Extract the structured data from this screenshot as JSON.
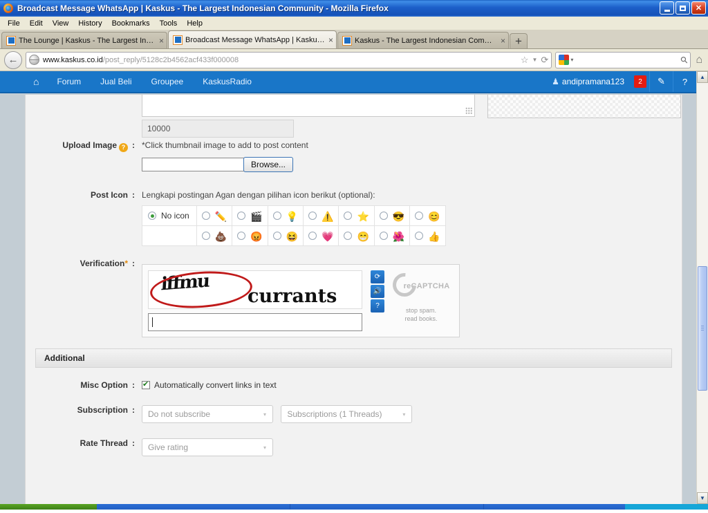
{
  "window": {
    "title": "Broadcast Message WhatsApp | Kaskus - The Largest Indonesian Community - Mozilla Firefox",
    "minimize_label": "Minimize",
    "restore_label": "Restore",
    "close_label": "Close"
  },
  "menu": [
    {
      "label": "File"
    },
    {
      "label": "Edit"
    },
    {
      "label": "View"
    },
    {
      "label": "History"
    },
    {
      "label": "Bookmarks"
    },
    {
      "label": "Tools"
    },
    {
      "label": "Help"
    }
  ],
  "tabs": [
    {
      "title": "The Lounge | Kaskus - The Largest Indon...",
      "active": false,
      "close": "×"
    },
    {
      "title": "Broadcast Message WhatsApp | Kaskus -...",
      "active": true,
      "close": "×"
    },
    {
      "title": "Kaskus - The Largest Indonesian Commu...",
      "active": false,
      "close": "×"
    }
  ],
  "new_tab_label": "+",
  "toolbar": {
    "back_icon": "←",
    "url_domain": "www.kaskus.co.id",
    "url_path": "/post_reply/5128c2b4562acf433f000008",
    "bookmark_icon": "☆",
    "bookmark_caret": "▼",
    "reload_icon": "⟳",
    "search_caret": "▾",
    "search_icon": "⚲",
    "search_placeholder": "",
    "home_icon": "⌂"
  },
  "site_nav": {
    "home_icon": "⌂",
    "items": [
      {
        "label": "Forum"
      },
      {
        "label": "Jual Beli"
      },
      {
        "label": "Groupee"
      },
      {
        "label": "KaskusRadio"
      }
    ],
    "user_icon": "♟",
    "username": "andipramana123",
    "badge_count": "2",
    "pencil_icon": "✎",
    "help_icon": "?"
  },
  "form": {
    "char_counter_value": "10000",
    "upload_image": {
      "label": "Upload Image",
      "help_icon": "?",
      "colon": ":",
      "hint": "*Click thumbnail image to add to post content",
      "file_value": "",
      "browse_label": "Browse..."
    },
    "post_icon": {
      "label": "Post Icon",
      "colon": ":",
      "hint": "Lengkapi postingan Agan dengan pilihan icon berikut (optional):",
      "no_icon_label": "No icon",
      "no_icon_selected": true,
      "row1": [
        {
          "name": "pencil-icon",
          "glyph": "✏️",
          "selected": false
        },
        {
          "name": "clapperboard-icon",
          "glyph": "🎬",
          "selected": false
        },
        {
          "name": "lightbulb-icon",
          "glyph": "💡",
          "selected": false
        },
        {
          "name": "warning-icon",
          "glyph": "⚠️",
          "selected": false
        },
        {
          "name": "star-icon",
          "glyph": "⭐",
          "selected": false
        },
        {
          "name": "cool-face-icon",
          "glyph": "😎",
          "selected": false
        },
        {
          "name": "smiley-face-icon",
          "glyph": "😊",
          "selected": false
        }
      ],
      "row2": [
        {
          "name": "poop-icon",
          "glyph": "💩",
          "selected": false
        },
        {
          "name": "red-face-icon",
          "glyph": "😡",
          "selected": false
        },
        {
          "name": "laughing-face-icon",
          "glyph": "😆",
          "selected": false
        },
        {
          "name": "heart-icon",
          "glyph": "💗",
          "selected": false
        },
        {
          "name": "blue-grin-face-icon",
          "glyph": "😁",
          "selected": false
        },
        {
          "name": "flower-icon",
          "glyph": "🌺",
          "selected": false
        },
        {
          "name": "thumbs-up-icon",
          "glyph": "👍",
          "selected": false
        }
      ]
    },
    "verification": {
      "label": "Verification",
      "required_mark": "*",
      "colon": ":",
      "captcha_word_1": "iffmu",
      "captcha_word_2": "currants",
      "input_value": "",
      "refresh_icon": "⟳",
      "audio_icon": "🔊",
      "help_icon": "?",
      "logo_text": "reCAPTCHA",
      "logo_tm": "™",
      "tagline_line1": "stop spam.",
      "tagline_line2": "read books."
    }
  },
  "additional": {
    "section_title": "Additional",
    "misc_option": {
      "label": "Misc Option",
      "colon": ":",
      "checkbox_label": "Automatically convert links in text",
      "checked": true
    },
    "subscription": {
      "label": "Subscription",
      "colon": ":",
      "select1_value": "Do not subscribe",
      "select2_value": "Subscriptions (1 Threads)",
      "arrow": "▾"
    },
    "rate_thread": {
      "label": "Rate Thread",
      "colon": ":",
      "select_value": "Give rating",
      "arrow": "▾"
    }
  },
  "scrollbar": {
    "up_arrow": "▲",
    "down_arrow": "▼"
  },
  "colors": {
    "kaskus_blue": "#1976c8",
    "badge_red": "#e51c12",
    "title_blue": "#1c5fc9",
    "captcha_circle_red": "#c01a1a"
  }
}
